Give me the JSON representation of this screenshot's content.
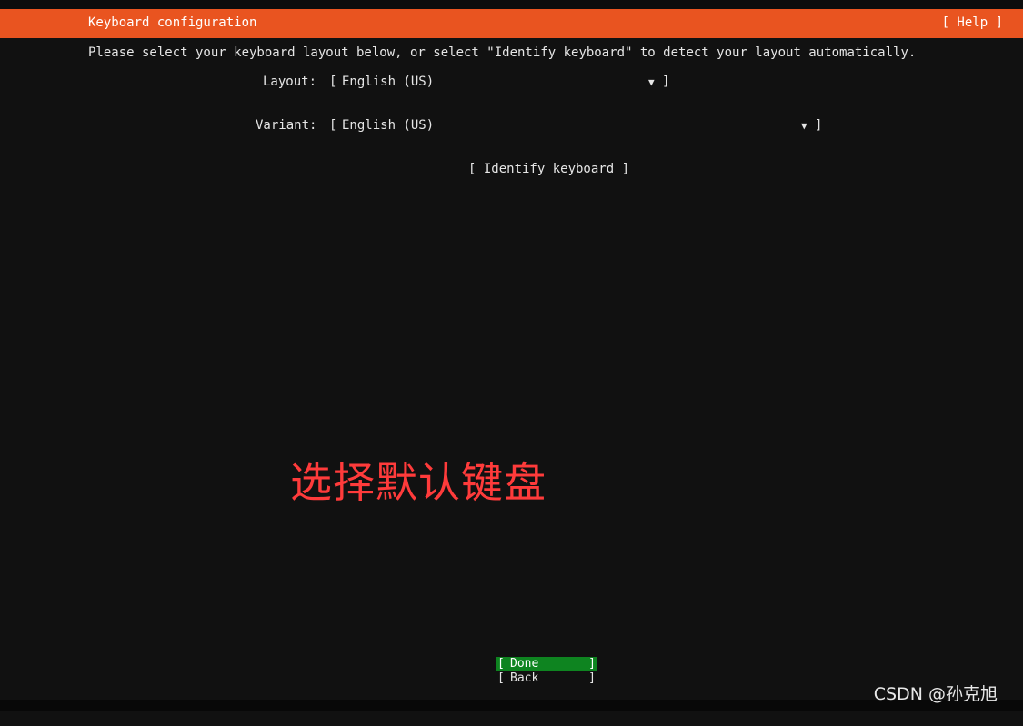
{
  "header": {
    "title": "Keyboard configuration",
    "help_label": "[ Help ]"
  },
  "intro_text": "Please select your keyboard layout below, or select \"Identify keyboard\" to detect your layout automatically.",
  "layout_field": {
    "label": "Layout:",
    "value": "English (US)",
    "open_bracket": "[",
    "close_bracket": "]",
    "arrow": "▼"
  },
  "variant_field": {
    "label": "Variant:",
    "value": "English (US)",
    "open_bracket": "[",
    "close_bracket": "]",
    "arrow": "▼"
  },
  "identify_button": "[ Identify keyboard ]",
  "annotation_text": "选择默认键盘",
  "buttons": {
    "open_bracket": "[",
    "close_bracket": "]",
    "done": "Done",
    "back": "Back"
  },
  "watermark": "CSDN @孙克旭",
  "colors": {
    "header_bg": "#e95420",
    "done_bg": "#0e8420",
    "background": "#111111",
    "annotation": "#ff3b3b"
  }
}
